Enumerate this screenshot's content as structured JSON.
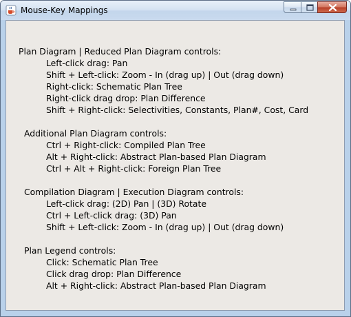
{
  "window": {
    "title": "Mouse-Key Mappings",
    "icon": "java-coffee-cup-icon"
  },
  "title_controls": [
    "minimize-icon",
    "maximize-icon",
    "close-icon"
  ],
  "sections": [
    {
      "heading": "Plan Diagram | Reduced Plan Diagram controls:",
      "items": [
        "Left-click drag: Pan",
        "Shift + Left-click: Zoom - In (drag up) | Out (drag down)",
        "Right-click: Schematic Plan Tree",
        "Right-click drag drop: Plan Difference",
        "Shift + Right-click: Selectivities, Constants, Plan#, Cost, Card"
      ]
    },
    {
      "heading": "Additional Plan Diagram controls:",
      "items": [
        "Ctrl + Right-click: Compiled Plan Tree",
        "Alt + Right-click: Abstract Plan-based Plan Diagram",
        "Ctrl + Alt + Right-click: Foreign Plan Tree"
      ]
    },
    {
      "heading": "Compilation Diagram | Execution Diagram controls:",
      "items": [
        "Left-click drag: (2D) Pan | (3D) Rotate",
        "Ctrl + Left-click drag: (3D) Pan",
        "Shift + Left-click: Zoom - In (drag up) | Out (drag down)"
      ]
    },
    {
      "heading": "Plan Legend controls:",
      "items": [
        "Click: Schematic Plan Tree",
        "Click drag drop: Plan Difference",
        "Alt + Right-click: Abstract Plan-based Plan Diagram"
      ]
    }
  ]
}
